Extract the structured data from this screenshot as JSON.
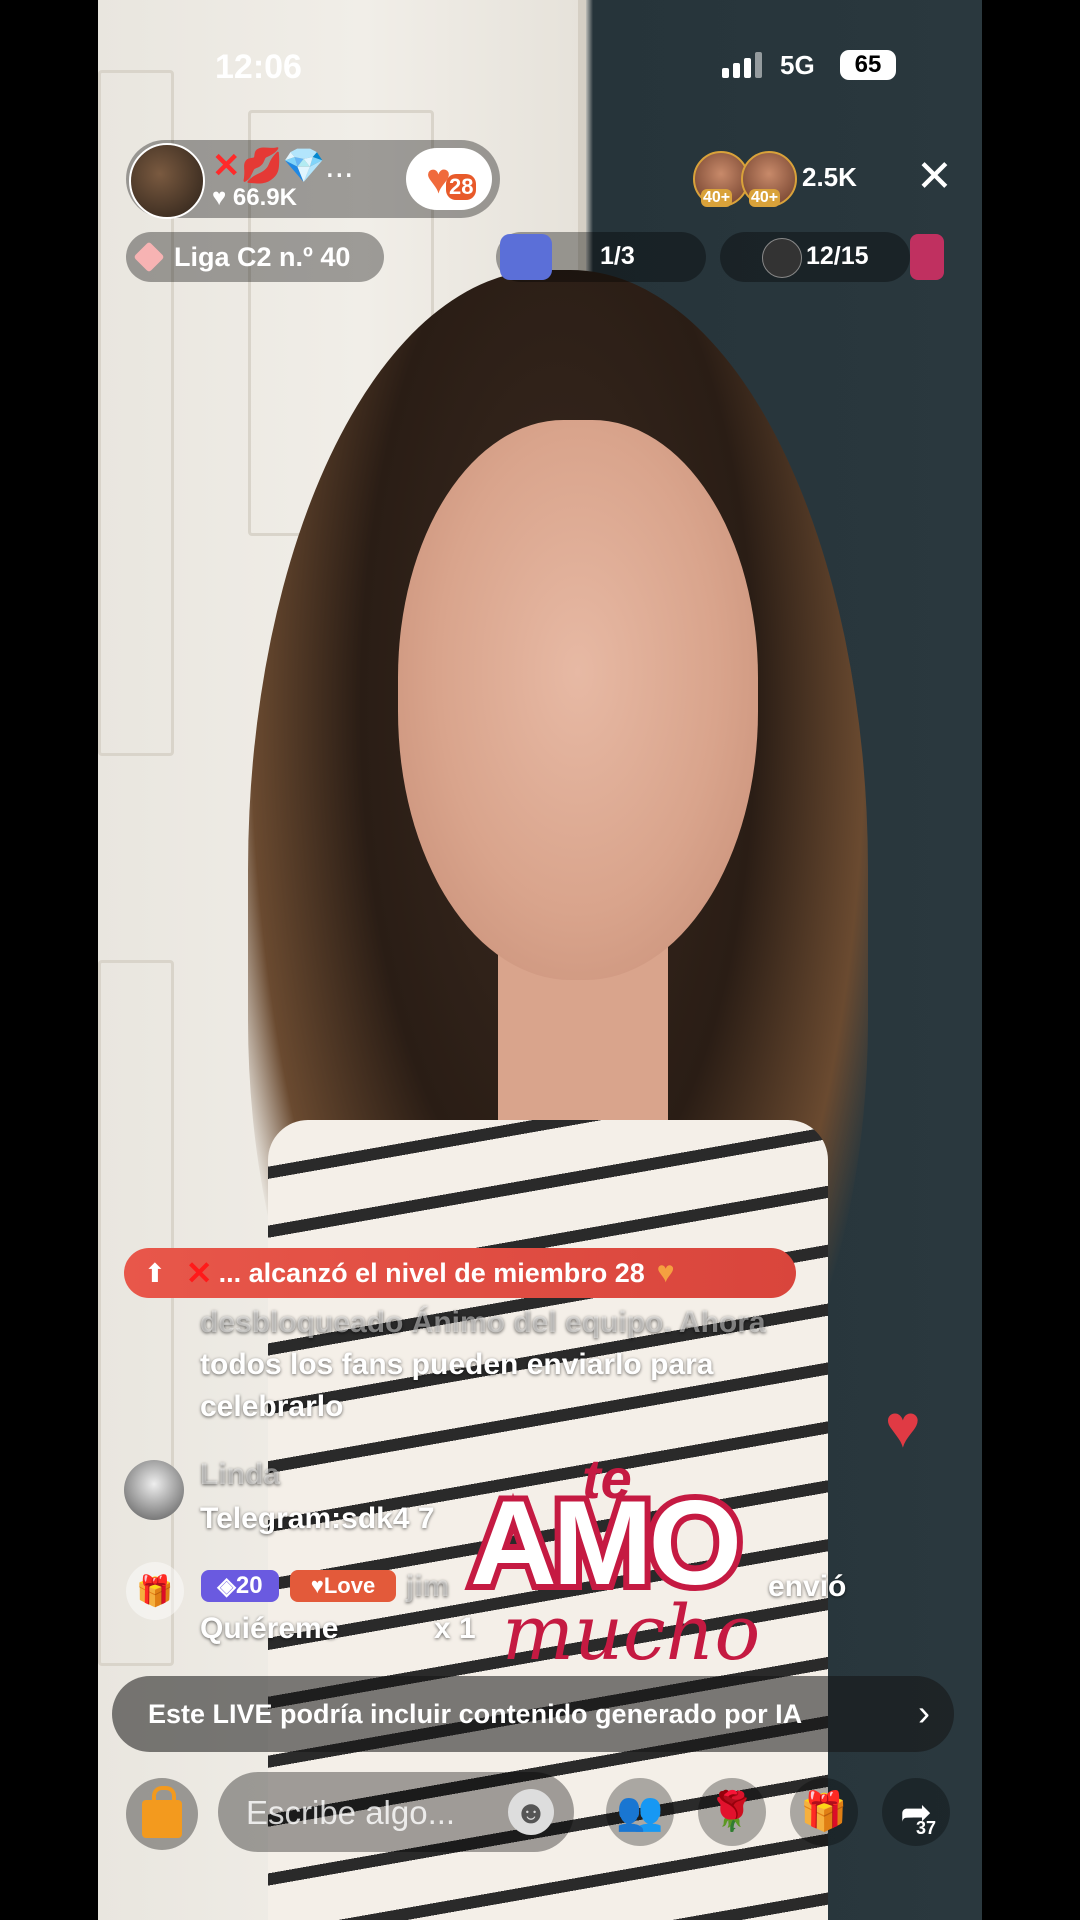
{
  "status_bar": {
    "time": "12:06",
    "network": "5G",
    "battery": "65"
  },
  "host": {
    "name_emoji": "💋💎...",
    "likes": "♥ 66.9K",
    "member_level": "28"
  },
  "viewers": {
    "badge1": "40+",
    "badge2": "40+",
    "count": "2.5K"
  },
  "league": {
    "label": "Liga C2 n.º 40"
  },
  "goal": {
    "progress": "1/3"
  },
  "rank": {
    "progress": "12/15"
  },
  "member_banner": {
    "text": "... alcanzó el nivel de miembro 28"
  },
  "chat": {
    "system_line1": "desbloqueado Ánimo del equipo. Ahora",
    "system_line2": "todos los fans pueden enviarlo para",
    "system_line3": "celebrarlo",
    "user_name": "Linda",
    "user_message": "Telegram:sdk4 7",
    "gift_level": "20",
    "gift_badge": "Love",
    "gift_user": "jim",
    "gift_action": "envió",
    "gift_name": "Quiéreme",
    "gift_count": "x 1"
  },
  "sticker": {
    "word_top": "te",
    "word_main": "AMO",
    "word_bottom": "mucho"
  },
  "ai_notice": {
    "text": "Este LIVE podría incluir contenido generado por IA"
  },
  "bottom_bar": {
    "comment_placeholder": "Escribe algo...",
    "share_count": "37"
  },
  "colors": {
    "accent_red": "#e8574a",
    "shop_orange": "#f39a1e",
    "sticker_red": "#c51a42"
  }
}
